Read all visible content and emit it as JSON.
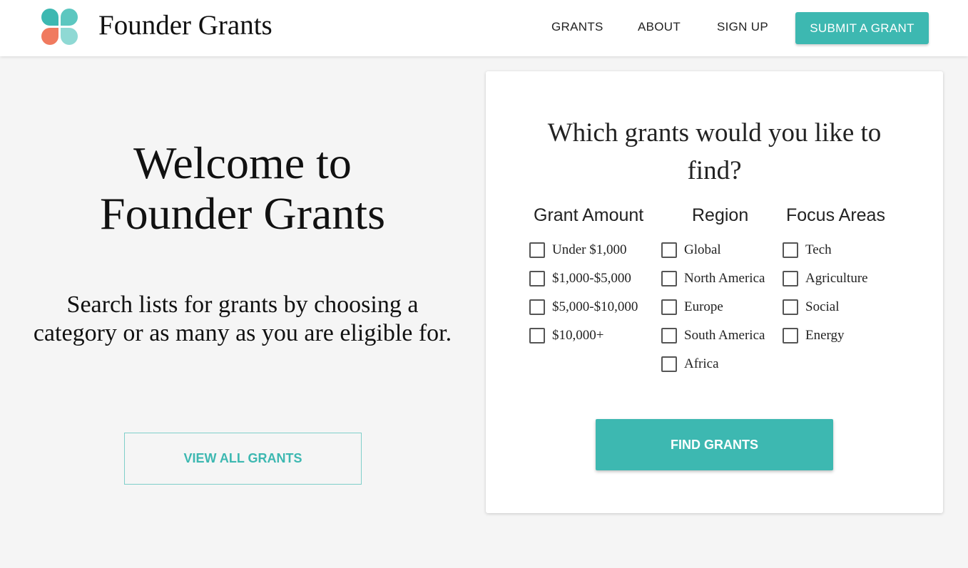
{
  "header": {
    "brand": "Founder Grants",
    "logo_icon": "four-petal-logo-icon",
    "nav": {
      "grants": "GRANTS",
      "about": "ABOUT",
      "signup": "SIGN UP"
    },
    "submit_button": "SUBMIT A GRANT"
  },
  "hero": {
    "title_line1": "Welcome to",
    "title_line2": "Founder Grants",
    "subtitle": "Search lists for grants by choosing a category or as many as you are eligible for.",
    "view_all_button": "VIEW ALL GRANTS"
  },
  "search_card": {
    "title": "Which grants would you like to find?",
    "columns": {
      "amount": {
        "heading": "Grant Amount",
        "options": [
          "Under $1,000",
          "$1,000-$5,000",
          "$5,000-$10,000",
          "$10,000+"
        ]
      },
      "region": {
        "heading": "Region",
        "options": [
          "Global",
          "North America",
          "Europe",
          "South America",
          "Africa"
        ]
      },
      "focus": {
        "heading": "Focus Areas",
        "options": [
          "Tech",
          "Agriculture",
          "Social",
          "Energy"
        ]
      }
    },
    "find_button": "FIND GRANTS"
  },
  "colors": {
    "accent": "#3db8b1",
    "logo_coral": "#f07a5f",
    "page_background": "#f5f5f5"
  }
}
